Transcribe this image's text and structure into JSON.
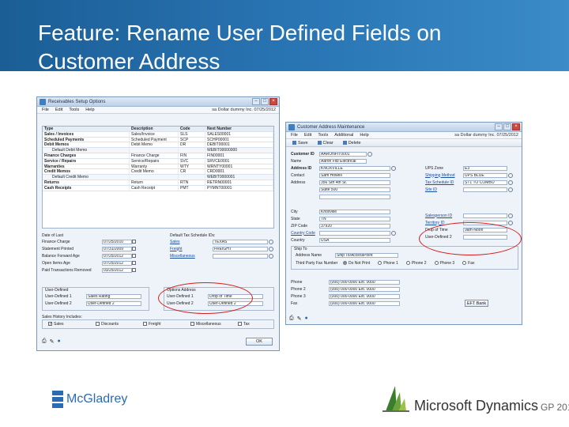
{
  "slide": {
    "title_line1": "Feature: Rename User Defined Fields on",
    "title_line2": "Customer Address",
    "colors": {
      "banner": "#1b5e96",
      "highlight": "#d81b1b"
    }
  },
  "receivables_window": {
    "title": "Receivables Setup Options",
    "menu": [
      "File",
      "Edit",
      "Tools",
      "Help"
    ],
    "company": "sa  Dollar dummy Inc.  07/25/2012",
    "columns": [
      "Type",
      "Description",
      "Code",
      "Next Number"
    ],
    "rows": [
      [
        "Sales / Invoices",
        "Sales/Invoice",
        "SLS",
        "SALES00001"
      ],
      [
        "Scheduled Payments",
        "Scheduled Payment",
        "SCP",
        "SCHP00001"
      ],
      [
        "Debit Memos",
        "Debit Memo",
        "DR",
        "DEBIT00001"
      ],
      [
        "Default Debit Memo",
        "",
        "",
        "WEBIT00000000"
      ],
      [
        "Finance Charges",
        "Finance Charge",
        "FIN",
        "FIN00001"
      ],
      [
        "Service / Repairs",
        "Service/Repairs",
        "SVC",
        "SRVCE0001"
      ],
      [
        "Warranties",
        "Warranty",
        "WTY",
        "WRNTY00001"
      ],
      [
        "Credit Memos",
        "Credit Memo",
        "CR",
        "CRD0001"
      ],
      [
        "Default Credit Memo",
        "",
        "",
        "WEBIT0000001"
      ],
      [
        "Returns",
        "Return",
        "RTN",
        "RETRN00001"
      ],
      [
        "Cash Receipts",
        "Cash Receipt",
        "PMT",
        "PYMNT00001"
      ]
    ],
    "date_header": "Date of Last",
    "date_rows": [
      [
        "Finance Charge",
        "07/25/2010"
      ],
      [
        "Statement Printed",
        "07/31/2009"
      ],
      [
        "Balance Forward Age",
        "07/25/2012"
      ],
      [
        "Open Items Age",
        "07/25/2012"
      ],
      [
        "Paid Transactions Removed",
        "03/25/2012"
      ]
    ],
    "default_tax_header": "Default Tax Schedule IDs:",
    "tax_rows": [
      [
        "Sales",
        "TEXAS"
      ],
      [
        "Freight",
        "FREIGHT"
      ],
      [
        "Miscellaneous",
        ""
      ]
    ],
    "user_defined_group": "User-Defined",
    "user_defined_rows": [
      [
        "User-Defined 1",
        "Sales Rating"
      ],
      [
        "User-Defined 2",
        "User-Defined 2"
      ]
    ],
    "address_user_defined_group": "Options Address",
    "address_user_defined_rows": [
      [
        "User-Defined 1",
        "Drop of Time"
      ],
      [
        "User-Defined 2",
        "User-Defined 2"
      ]
    ],
    "sales_history_label": "Sales History Includes:",
    "sales_history": [
      {
        "label": "Sales",
        "checked": true
      },
      {
        "label": "Discounts",
        "checked": false
      },
      {
        "label": "Freight",
        "checked": false
      },
      {
        "label": "Miscellaneous",
        "checked": false
      },
      {
        "label": "Tax",
        "checked": false
      }
    ],
    "ok_label": "OK"
  },
  "customer_window": {
    "title": "Customer Address Maintenance",
    "menu": [
      "File",
      "Edit",
      "Tools",
      "Additional",
      "Help"
    ],
    "company": "sa  Dollar dummy Inc.  07/25/2012",
    "toolbar": [
      "Save",
      "Clear",
      "Delete"
    ],
    "fields_left": [
      {
        "label": "Customer ID",
        "value": "AARONFIT0001"
      },
      {
        "label": "Name",
        "value": "Aaron Fitz Electrical"
      },
      {
        "label": "Address ID",
        "value": "KNOXVILLE"
      },
      {
        "label": "Contact",
        "value": "Sam Howell"
      },
      {
        "label": "Address",
        "value": "356 Sth 4th St."
      },
      {
        "label": "",
        "value": "Suite 500"
      },
      {
        "label": "",
        "value": ""
      },
      {
        "label": "City",
        "value": "Knoxville"
      },
      {
        "label": "State",
        "value": "TN"
      },
      {
        "label": "ZIP Code",
        "value": "37920"
      },
      {
        "label": "Country Code",
        "value": ""
      },
      {
        "label": "Country",
        "value": "USA"
      }
    ],
    "fields_right": [
      {
        "label": "UPS Zone",
        "value": "E3"
      },
      {
        "label": "Shipping Method",
        "value": "UPS BLUE"
      },
      {
        "label": "Tax Schedule ID",
        "value": "ST1 TO COMBO"
      },
      {
        "label": "Site ID",
        "value": ""
      },
      {
        "label": "Salesperson ID",
        "value": ""
      },
      {
        "label": "Territory ID",
        "value": ""
      },
      {
        "label": "Drop of Time",
        "value": "9am-Noon"
      },
      {
        "label": "User-Defined 2",
        "value": ""
      }
    ],
    "ship_to": {
      "label": "Ship To",
      "address_name_label": "Address Name",
      "address_name_value": "Ship To/AccessPoint",
      "third_party_label": "Third Party Fax Number",
      "radio_options": [
        "Do Not Print",
        "Phone 1",
        "Phone 2",
        "Phone 3",
        "Fax"
      ]
    },
    "phones": [
      {
        "label": "Phone",
        "value": "(000) 000-0000  Ext. 0000"
      },
      {
        "label": "Phone 2",
        "value": "(000) 000-0000  Ext. 0000"
      },
      {
        "label": "Phone 3",
        "value": "(000) 000-0000  Ext. 0000"
      },
      {
        "label": "Fax",
        "value": "(000) 000-0000  Ext. 0000"
      }
    ],
    "eft_label": "EFT Bank"
  },
  "logos": {
    "left": "McGladrey",
    "right": "Microsoft Dynamics",
    "right_version": "GP 2013",
    "left_color": "#2a6bb3"
  }
}
